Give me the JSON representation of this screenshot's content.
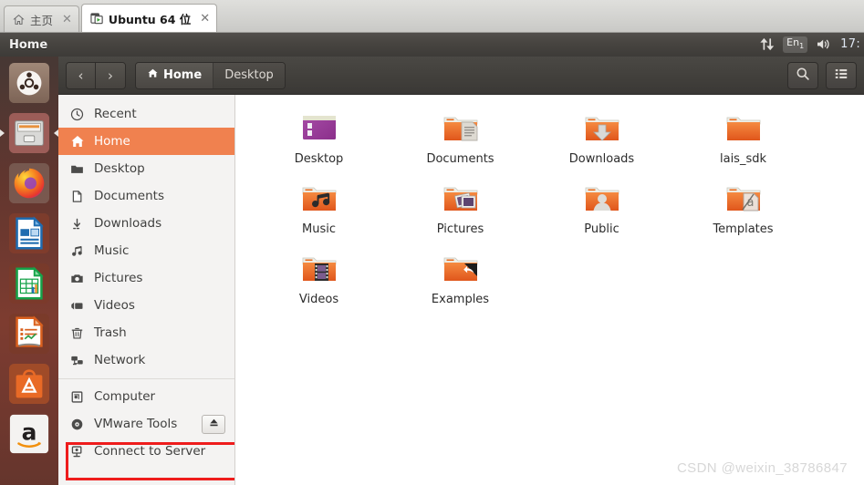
{
  "vmware": {
    "tabs": [
      {
        "label": "主页",
        "icon": "home-icon",
        "active": false,
        "close": "✕"
      },
      {
        "label": "Ubuntu 64 位",
        "icon": "vm-window-icon",
        "active": true,
        "close": "✕"
      }
    ]
  },
  "top_panel": {
    "title": "Home",
    "indicators": {
      "network_icon": "network-updown-icon",
      "keyboard_label": "En",
      "keyboard_sub": "1",
      "volume_icon": "volume-icon",
      "clock": "17:"
    }
  },
  "launcher": {
    "items": [
      {
        "name": "ubuntu-dash",
        "label": "Ubuntu Dash",
        "running": false
      },
      {
        "name": "files",
        "label": "Files",
        "running": true
      },
      {
        "name": "firefox",
        "label": "Firefox",
        "running": false
      },
      {
        "name": "libreoffice-writer",
        "label": "LibreOffice Writer",
        "running": false
      },
      {
        "name": "libreoffice-calc",
        "label": "LibreOffice Calc",
        "running": false
      },
      {
        "name": "libreoffice-impress",
        "label": "LibreOffice Impress",
        "running": false
      },
      {
        "name": "ubuntu-software",
        "label": "Ubuntu Software",
        "running": false
      },
      {
        "name": "amazon",
        "label": "Amazon",
        "running": false
      }
    ]
  },
  "file_manager": {
    "toolbar": {
      "back_label": "‹",
      "forward_label": "›",
      "search_icon": "search-icon",
      "view_icon": "list-view-icon"
    },
    "breadcrumbs": [
      {
        "label": "Home",
        "icon": "home-icon",
        "current": true
      },
      {
        "label": "Desktop",
        "icon": "",
        "current": false
      }
    ],
    "sidebar": [
      {
        "label": "Recent",
        "icon": "clock-icon",
        "selected": false,
        "eject": false
      },
      {
        "label": "Home",
        "icon": "home-icon",
        "selected": true,
        "eject": false
      },
      {
        "label": "Desktop",
        "icon": "folder-icon",
        "selected": false,
        "eject": false
      },
      {
        "label": "Documents",
        "icon": "document-icon",
        "selected": false,
        "eject": false
      },
      {
        "label": "Downloads",
        "icon": "download-icon",
        "selected": false,
        "eject": false
      },
      {
        "label": "Music",
        "icon": "music-icon",
        "selected": false,
        "eject": false
      },
      {
        "label": "Pictures",
        "icon": "camera-icon",
        "selected": false,
        "eject": false
      },
      {
        "label": "Videos",
        "icon": "video-icon",
        "selected": false,
        "eject": false
      },
      {
        "label": "Trash",
        "icon": "trash-icon",
        "selected": false,
        "eject": false
      },
      {
        "label": "Network",
        "icon": "network-icon",
        "selected": false,
        "eject": false
      },
      {
        "separator": true
      },
      {
        "label": "Computer",
        "icon": "computer-icon",
        "selected": false,
        "eject": false
      },
      {
        "label": "VMware Tools",
        "icon": "disc-icon",
        "selected": false,
        "eject": true,
        "eject_icon": "eject-icon",
        "annotated": true
      },
      {
        "label": "Connect to Server",
        "icon": "connect-server-icon",
        "selected": false,
        "eject": false
      }
    ],
    "files": [
      {
        "name": "Desktop",
        "icon": "desktop-folder-icon"
      },
      {
        "name": "Documents",
        "icon": "documents-folder-icon"
      },
      {
        "name": "Downloads",
        "icon": "downloads-folder-icon"
      },
      {
        "name": "lais_sdk",
        "icon": "folder-icon"
      },
      {
        "name": "Music",
        "icon": "music-folder-icon"
      },
      {
        "name": "Pictures",
        "icon": "pictures-folder-icon"
      },
      {
        "name": "Public",
        "icon": "public-folder-icon"
      },
      {
        "name": "Templates",
        "icon": "templates-folder-icon"
      },
      {
        "name": "Videos",
        "icon": "videos-folder-icon"
      },
      {
        "name": "Examples",
        "icon": "examples-link-folder-icon"
      }
    ]
  },
  "watermark": "CSDN @weixin_38786847",
  "colors": {
    "accent_orange": "#f0814f",
    "annotation_red": "#ee1c1c",
    "panel_dark": "#474440",
    "sidebar_bg": "#f4f3f2"
  }
}
